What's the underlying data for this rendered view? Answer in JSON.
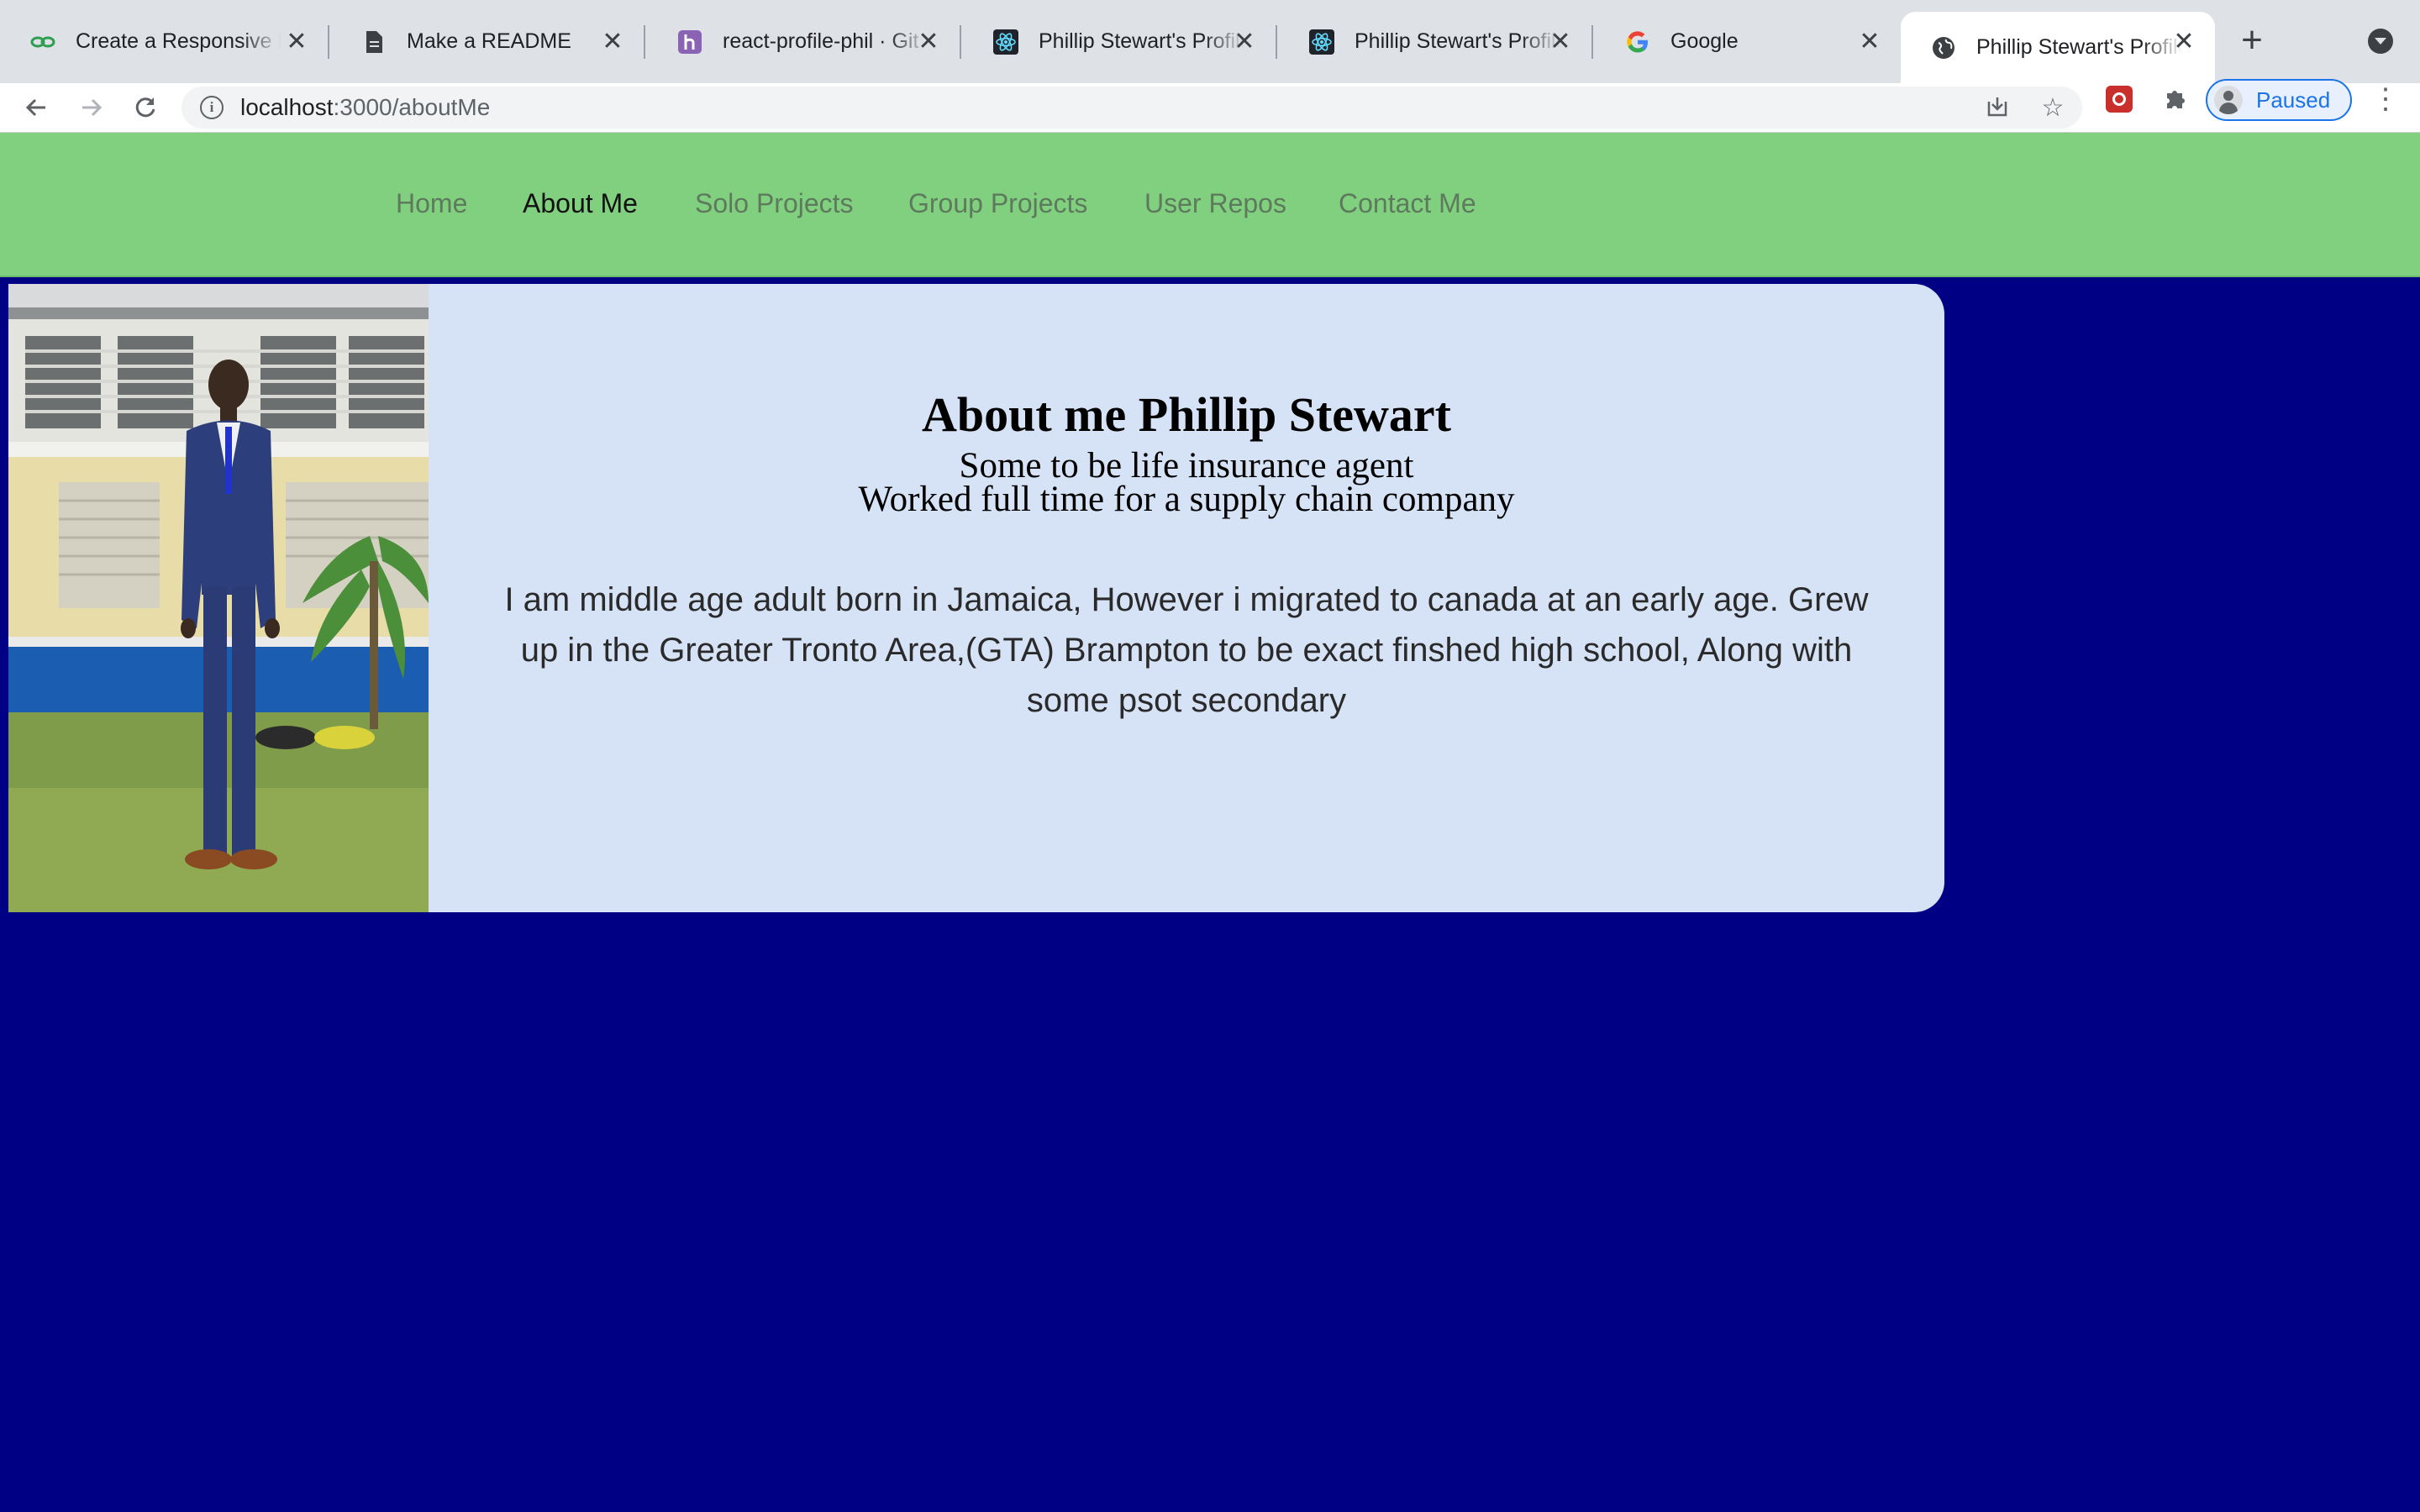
{
  "browser": {
    "tabs": [
      {
        "title": "Create a Responsive N",
        "favicon": "link-icon",
        "active": false
      },
      {
        "title": "Make a README",
        "favicon": "document-icon",
        "active": false
      },
      {
        "title": "react-profile-phil · Git",
        "favicon": "heroku-icon",
        "active": false
      },
      {
        "title": "Phillip Stewart's Profile",
        "favicon": "react-icon",
        "active": false
      },
      {
        "title": "Phillip Stewart's Profile",
        "favicon": "react-icon",
        "active": false
      },
      {
        "title": "Google",
        "favicon": "google-icon",
        "active": false
      },
      {
        "title": "Phillip Stewart's Profile",
        "favicon": "globe-icon",
        "active": true
      }
    ],
    "url_host": "localhost",
    "url_path": ":3000/aboutMe",
    "profile_label": "Paused"
  },
  "site": {
    "nav": [
      {
        "label": "Home",
        "active": false
      },
      {
        "label": "About Me",
        "active": true
      },
      {
        "label": "Solo Projects",
        "active": false
      },
      {
        "label": "Group Projects",
        "active": false
      },
      {
        "label": "User Repos",
        "active": false
      },
      {
        "label": "Contact Me",
        "active": false
      }
    ],
    "colors": {
      "nav_bg": "#80d07f",
      "page_bg": "#000084",
      "card_bg": "#d6e2f5"
    },
    "about": {
      "heading": "About me Phillip Stewart",
      "line1": "Some to be life insurance agent",
      "line2": "Worked full time for a supply chain company",
      "paragraph": "I am middle age adult born in Jamaica, However i migrated to canada at an early age. Grew up in the Greater Tronto Area,(GTA) Brampton to be exact finshed high school, Along with some psot secondary"
    }
  }
}
